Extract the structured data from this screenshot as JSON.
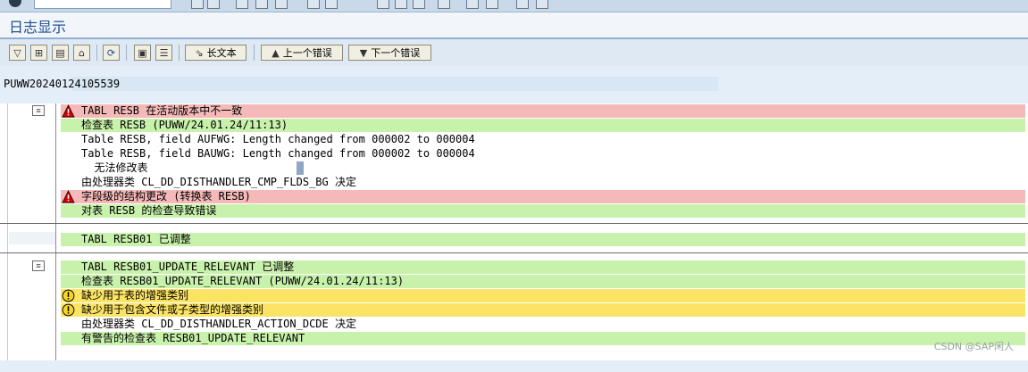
{
  "window": {
    "title": "日志显示"
  },
  "toolbar": {
    "long_text_label": "长文本",
    "prev_error_label": "上一个错误",
    "next_error_label": "下一个错误"
  },
  "header": {
    "id": "PUWW20240124105539"
  },
  "groups": [
    {
      "rows": [
        {
          "status": "error",
          "text": "TABL RESB 在活动版本中不一致"
        },
        {
          "status": "success",
          "text": "检查表 RESB (PUWW/24.01.24/11:13)"
        },
        {
          "status": "info",
          "text": "Table RESB, field AUFWG: Length changed from 000002 to 000004"
        },
        {
          "status": "info",
          "text": "Table RESB, field BAUWG: Length changed from 000002 to 000004"
        },
        {
          "status": "info",
          "text": "  无法修改表"
        },
        {
          "status": "info",
          "text": "由处理器类 CL_DD_DISTHANDLER_CMP_FLDS_BG 决定"
        },
        {
          "status": "error",
          "text": "字段级的结构更改 (转换表 RESB)"
        },
        {
          "status": "success",
          "text": "对表 RESB 的检查导致错误"
        }
      ]
    },
    {
      "rows": [
        {
          "status": "success",
          "text": "TABL RESB01 已调整"
        }
      ]
    },
    {
      "rows": [
        {
          "status": "success",
          "text": "TABL RESB01_UPDATE_RELEVANT 已调整"
        },
        {
          "status": "success",
          "text": "检查表 RESB01_UPDATE_RELEVANT (PUWW/24.01.24/11:13)"
        },
        {
          "status": "warning",
          "text": "缺少用于表的增强类别"
        },
        {
          "status": "warning",
          "text": "缺少用于包含文件或子类型的增强类别"
        },
        {
          "status": "info",
          "text": "由处理器类 CL_DD_DISTHANDLER_ACTION_DCDE 决定"
        },
        {
          "status": "success",
          "text": "有警告的检查表 RESB01_UPDATE_RELEVANT"
        }
      ]
    }
  ],
  "watermark": "CSDN @SAP闲人",
  "colors": {
    "error_row": "#f6b9b9",
    "success_row": "#c8f2ab",
    "warning_row": "#fbe463",
    "title_text": "#1d4f8f"
  }
}
